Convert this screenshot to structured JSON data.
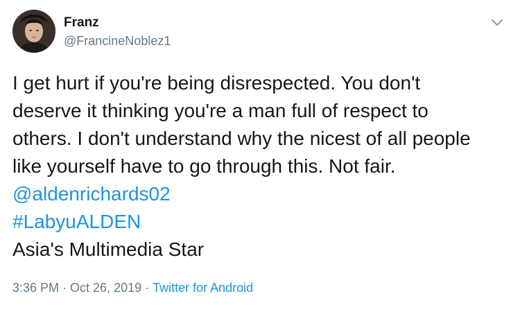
{
  "author": {
    "name": "Franz",
    "handle": "@FrancineNoblez1"
  },
  "tweet": {
    "lines": [
      "I get hurt if you're being disrespected. You don't",
      "deserve it thinking you're a man full of respect to",
      "others. I don't understand why the nicest of all people",
      "like yourself have to go through this. Not fair."
    ],
    "mention": "@aldenrichards02",
    "hashtag": "#LabyuALDEN",
    "tagline": "Asia's Multimedia Star"
  },
  "meta": {
    "time": "3:36 PM",
    "separator": "·",
    "date": "Oct 26, 2019",
    "source": "Twitter for Android"
  },
  "icons": {
    "menu": "chevron-down-icon",
    "avatar": "profile-photo"
  },
  "colors": {
    "text": "#14171a",
    "secondary": "#657786",
    "link": "#1b95e0",
    "background": "#ffffff"
  }
}
